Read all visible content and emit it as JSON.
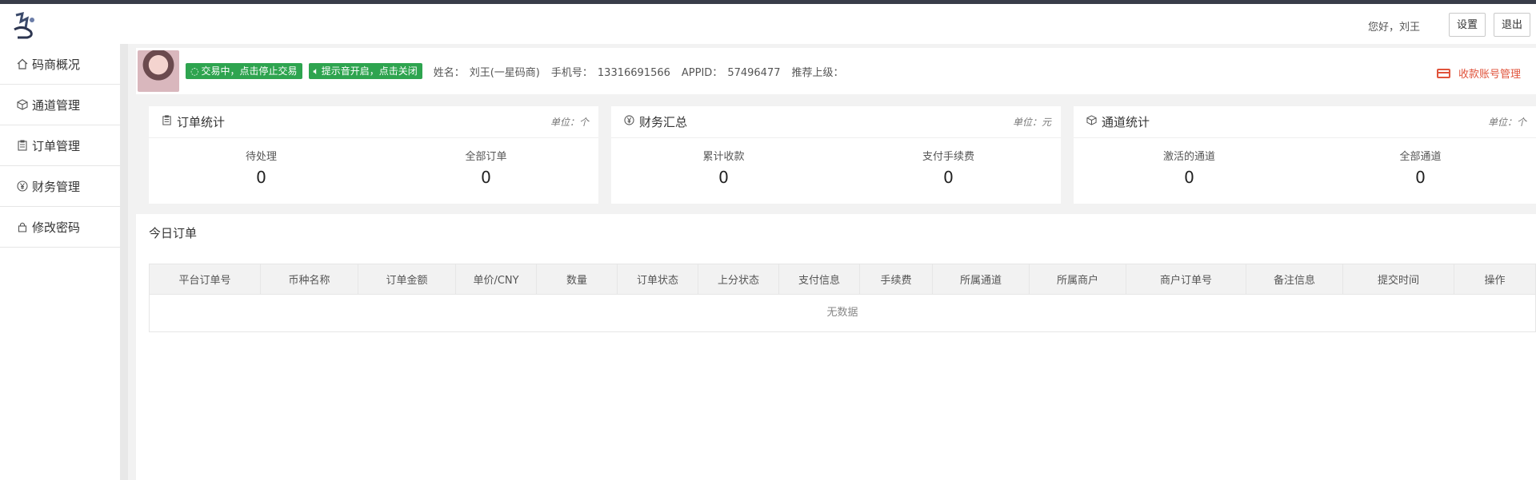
{
  "header": {
    "greeting": "您好，刘王",
    "settings_label": "设置",
    "logout_label": "退出"
  },
  "sidebar": {
    "items": [
      {
        "label": "码商概况",
        "icon": "home-icon"
      },
      {
        "label": "通道管理",
        "icon": "cube-icon"
      },
      {
        "label": "订单管理",
        "icon": "clipboard-icon"
      },
      {
        "label": "财务管理",
        "icon": "yen-icon"
      },
      {
        "label": "修改密码",
        "icon": "lock-icon"
      }
    ]
  },
  "infobar": {
    "trading_button": "交易中，点击停止交易",
    "sound_button": "提示音开启，点击关闭",
    "name_label": "姓名：",
    "name_value": "刘王(一星码商)",
    "phone_label": "手机号：",
    "phone_value": "13316691566",
    "appid_label": "APPID：",
    "appid_value": "57496477",
    "referrer_label": "推荐上级：",
    "account_link": "收款账号管理",
    "accent_color": "#2ea44f",
    "link_color": "#e0533b"
  },
  "panels": [
    {
      "title": "订单统计",
      "unit": "单位：个",
      "icon": "clipboard-icon",
      "stats": [
        {
          "label": "待处理",
          "value": "0"
        },
        {
          "label": "全部订单",
          "value": "0"
        }
      ]
    },
    {
      "title": "财务汇总",
      "unit": "单位：元",
      "icon": "yen-icon",
      "stats": [
        {
          "label": "累计收款",
          "value": "0"
        },
        {
          "label": "支付手续费",
          "value": "0"
        }
      ]
    },
    {
      "title": "通道统计",
      "unit": "单位：个",
      "icon": "cube-icon",
      "stats": [
        {
          "label": "激活的通道",
          "value": "0"
        },
        {
          "label": "全部通道",
          "value": "0"
        }
      ]
    }
  ],
  "orders": {
    "title": "今日订单",
    "columns": [
      "平台订单号",
      "币种名称",
      "订单金额",
      "单价/CNY",
      "数量",
      "订单状态",
      "上分状态",
      "支付信息",
      "手续费",
      "所属通道",
      "所属商户",
      "商户订单号",
      "备注信息",
      "提交时间",
      "操作"
    ],
    "empty_text": "无数据"
  }
}
